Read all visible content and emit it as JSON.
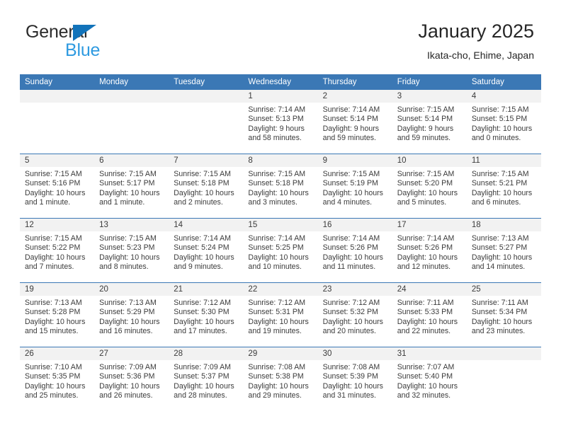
{
  "brand": {
    "name_top": "General",
    "name_bottom": "Blue",
    "triangle_color": "#1273ba",
    "bottom_color": "#2e9ae0"
  },
  "header": {
    "title": "January 2025",
    "subtitle": "Ikata-cho, Ehime, Japan",
    "accent_color": "#3b78b5",
    "band_color": "#f2f2f2"
  },
  "weekday_headers": [
    "Sunday",
    "Monday",
    "Tuesday",
    "Wednesday",
    "Thursday",
    "Friday",
    "Saturday"
  ],
  "weeks": [
    [
      {
        "day": "",
        "sunrise": "",
        "sunset": "",
        "daylight_1": "",
        "daylight_2": ""
      },
      {
        "day": "",
        "sunrise": "",
        "sunset": "",
        "daylight_1": "",
        "daylight_2": ""
      },
      {
        "day": "",
        "sunrise": "",
        "sunset": "",
        "daylight_1": "",
        "daylight_2": ""
      },
      {
        "day": "1",
        "sunrise": "Sunrise: 7:14 AM",
        "sunset": "Sunset: 5:13 PM",
        "daylight_1": "Daylight: 9 hours",
        "daylight_2": "and 58 minutes."
      },
      {
        "day": "2",
        "sunrise": "Sunrise: 7:14 AM",
        "sunset": "Sunset: 5:14 PM",
        "daylight_1": "Daylight: 9 hours",
        "daylight_2": "and 59 minutes."
      },
      {
        "day": "3",
        "sunrise": "Sunrise: 7:15 AM",
        "sunset": "Sunset: 5:14 PM",
        "daylight_1": "Daylight: 9 hours",
        "daylight_2": "and 59 minutes."
      },
      {
        "day": "4",
        "sunrise": "Sunrise: 7:15 AM",
        "sunset": "Sunset: 5:15 PM",
        "daylight_1": "Daylight: 10 hours",
        "daylight_2": "and 0 minutes."
      }
    ],
    [
      {
        "day": "5",
        "sunrise": "Sunrise: 7:15 AM",
        "sunset": "Sunset: 5:16 PM",
        "daylight_1": "Daylight: 10 hours",
        "daylight_2": "and 1 minute."
      },
      {
        "day": "6",
        "sunrise": "Sunrise: 7:15 AM",
        "sunset": "Sunset: 5:17 PM",
        "daylight_1": "Daylight: 10 hours",
        "daylight_2": "and 1 minute."
      },
      {
        "day": "7",
        "sunrise": "Sunrise: 7:15 AM",
        "sunset": "Sunset: 5:18 PM",
        "daylight_1": "Daylight: 10 hours",
        "daylight_2": "and 2 minutes."
      },
      {
        "day": "8",
        "sunrise": "Sunrise: 7:15 AM",
        "sunset": "Sunset: 5:18 PM",
        "daylight_1": "Daylight: 10 hours",
        "daylight_2": "and 3 minutes."
      },
      {
        "day": "9",
        "sunrise": "Sunrise: 7:15 AM",
        "sunset": "Sunset: 5:19 PM",
        "daylight_1": "Daylight: 10 hours",
        "daylight_2": "and 4 minutes."
      },
      {
        "day": "10",
        "sunrise": "Sunrise: 7:15 AM",
        "sunset": "Sunset: 5:20 PM",
        "daylight_1": "Daylight: 10 hours",
        "daylight_2": "and 5 minutes."
      },
      {
        "day": "11",
        "sunrise": "Sunrise: 7:15 AM",
        "sunset": "Sunset: 5:21 PM",
        "daylight_1": "Daylight: 10 hours",
        "daylight_2": "and 6 minutes."
      }
    ],
    [
      {
        "day": "12",
        "sunrise": "Sunrise: 7:15 AM",
        "sunset": "Sunset: 5:22 PM",
        "daylight_1": "Daylight: 10 hours",
        "daylight_2": "and 7 minutes."
      },
      {
        "day": "13",
        "sunrise": "Sunrise: 7:15 AM",
        "sunset": "Sunset: 5:23 PM",
        "daylight_1": "Daylight: 10 hours",
        "daylight_2": "and 8 minutes."
      },
      {
        "day": "14",
        "sunrise": "Sunrise: 7:14 AM",
        "sunset": "Sunset: 5:24 PM",
        "daylight_1": "Daylight: 10 hours",
        "daylight_2": "and 9 minutes."
      },
      {
        "day": "15",
        "sunrise": "Sunrise: 7:14 AM",
        "sunset": "Sunset: 5:25 PM",
        "daylight_1": "Daylight: 10 hours",
        "daylight_2": "and 10 minutes."
      },
      {
        "day": "16",
        "sunrise": "Sunrise: 7:14 AM",
        "sunset": "Sunset: 5:26 PM",
        "daylight_1": "Daylight: 10 hours",
        "daylight_2": "and 11 minutes."
      },
      {
        "day": "17",
        "sunrise": "Sunrise: 7:14 AM",
        "sunset": "Sunset: 5:26 PM",
        "daylight_1": "Daylight: 10 hours",
        "daylight_2": "and 12 minutes."
      },
      {
        "day": "18",
        "sunrise": "Sunrise: 7:13 AM",
        "sunset": "Sunset: 5:27 PM",
        "daylight_1": "Daylight: 10 hours",
        "daylight_2": "and 14 minutes."
      }
    ],
    [
      {
        "day": "19",
        "sunrise": "Sunrise: 7:13 AM",
        "sunset": "Sunset: 5:28 PM",
        "daylight_1": "Daylight: 10 hours",
        "daylight_2": "and 15 minutes."
      },
      {
        "day": "20",
        "sunrise": "Sunrise: 7:13 AM",
        "sunset": "Sunset: 5:29 PM",
        "daylight_1": "Daylight: 10 hours",
        "daylight_2": "and 16 minutes."
      },
      {
        "day": "21",
        "sunrise": "Sunrise: 7:12 AM",
        "sunset": "Sunset: 5:30 PM",
        "daylight_1": "Daylight: 10 hours",
        "daylight_2": "and 17 minutes."
      },
      {
        "day": "22",
        "sunrise": "Sunrise: 7:12 AM",
        "sunset": "Sunset: 5:31 PM",
        "daylight_1": "Daylight: 10 hours",
        "daylight_2": "and 19 minutes."
      },
      {
        "day": "23",
        "sunrise": "Sunrise: 7:12 AM",
        "sunset": "Sunset: 5:32 PM",
        "daylight_1": "Daylight: 10 hours",
        "daylight_2": "and 20 minutes."
      },
      {
        "day": "24",
        "sunrise": "Sunrise: 7:11 AM",
        "sunset": "Sunset: 5:33 PM",
        "daylight_1": "Daylight: 10 hours",
        "daylight_2": "and 22 minutes."
      },
      {
        "day": "25",
        "sunrise": "Sunrise: 7:11 AM",
        "sunset": "Sunset: 5:34 PM",
        "daylight_1": "Daylight: 10 hours",
        "daylight_2": "and 23 minutes."
      }
    ],
    [
      {
        "day": "26",
        "sunrise": "Sunrise: 7:10 AM",
        "sunset": "Sunset: 5:35 PM",
        "daylight_1": "Daylight: 10 hours",
        "daylight_2": "and 25 minutes."
      },
      {
        "day": "27",
        "sunrise": "Sunrise: 7:09 AM",
        "sunset": "Sunset: 5:36 PM",
        "daylight_1": "Daylight: 10 hours",
        "daylight_2": "and 26 minutes."
      },
      {
        "day": "28",
        "sunrise": "Sunrise: 7:09 AM",
        "sunset": "Sunset: 5:37 PM",
        "daylight_1": "Daylight: 10 hours",
        "daylight_2": "and 28 minutes."
      },
      {
        "day": "29",
        "sunrise": "Sunrise: 7:08 AM",
        "sunset": "Sunset: 5:38 PM",
        "daylight_1": "Daylight: 10 hours",
        "daylight_2": "and 29 minutes."
      },
      {
        "day": "30",
        "sunrise": "Sunrise: 7:08 AM",
        "sunset": "Sunset: 5:39 PM",
        "daylight_1": "Daylight: 10 hours",
        "daylight_2": "and 31 minutes."
      },
      {
        "day": "31",
        "sunrise": "Sunrise: 7:07 AM",
        "sunset": "Sunset: 5:40 PM",
        "daylight_1": "Daylight: 10 hours",
        "daylight_2": "and 32 minutes."
      },
      {
        "day": "",
        "sunrise": "",
        "sunset": "",
        "daylight_1": "",
        "daylight_2": ""
      }
    ]
  ]
}
